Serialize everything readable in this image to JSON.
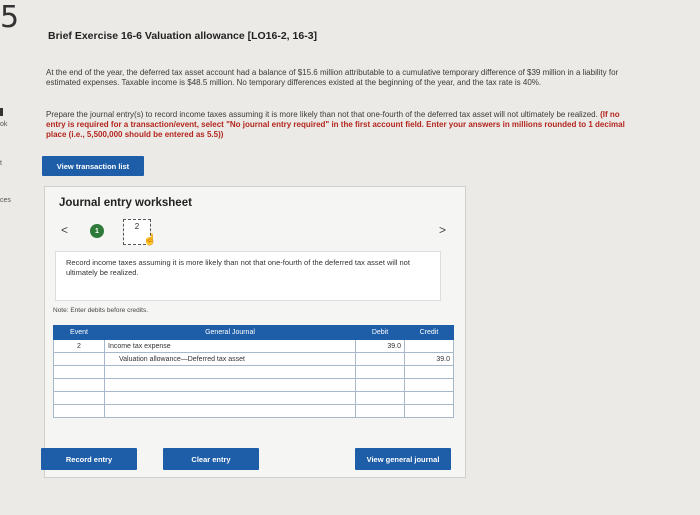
{
  "page_number": "5",
  "sidebar": {
    "frag_ok": "ok",
    "frag_t": "t",
    "frag_ces": "ces"
  },
  "title": "Brief Exercise 16-6 Valuation allowance [LO16-2, 16-3]",
  "paragraph1": "At the end of the year, the deferred tax asset account had a balance of $15.6 million attributable to a cumulative temporary difference of $39 million in a liability for estimated expenses. Taxable income is $48.5 million. No temporary differences existed at the beginning of the year, and the tax rate is 40%.",
  "paragraph2_main": "Prepare the journal entry(s) to record income taxes assuming it is more likely than not that one-fourth of the deferred tax asset will not ultimately be realized.",
  "paragraph2_red": "(If no entry is required for a transaction/event, select \"No journal entry required\" in the first account field. Enter your answers in millions rounded to 1 decimal place (i.e., 5,500,000 should be entered as 5.5))",
  "view_transaction_list": "View transaction list",
  "worksheet": {
    "title": "Journal entry worksheet",
    "prev": "<",
    "next": ">",
    "step1": "1",
    "step2": "2",
    "instruction": "Record income taxes assuming it is more likely than not that one-fourth of the deferred tax asset will not ultimately be realized.",
    "note": "Note: Enter debits before credits.",
    "columns": {
      "event": "Event",
      "journal": "General Journal",
      "debit": "Debit",
      "credit": "Credit"
    },
    "rows": [
      {
        "event": "2",
        "account": "Income tax expense",
        "debit": "39.0",
        "credit": ""
      },
      {
        "event": "",
        "account": "Valuation allowance—Deferred tax asset",
        "debit": "",
        "credit": "39.0"
      },
      {
        "event": "",
        "account": "",
        "debit": "",
        "credit": ""
      },
      {
        "event": "",
        "account": "",
        "debit": "",
        "credit": ""
      },
      {
        "event": "",
        "account": "",
        "debit": "",
        "credit": ""
      },
      {
        "event": "",
        "account": "",
        "debit": "",
        "credit": ""
      }
    ],
    "record_entry": "Record entry",
    "clear_entry": "Clear entry",
    "view_general_journal": "View general journal"
  }
}
